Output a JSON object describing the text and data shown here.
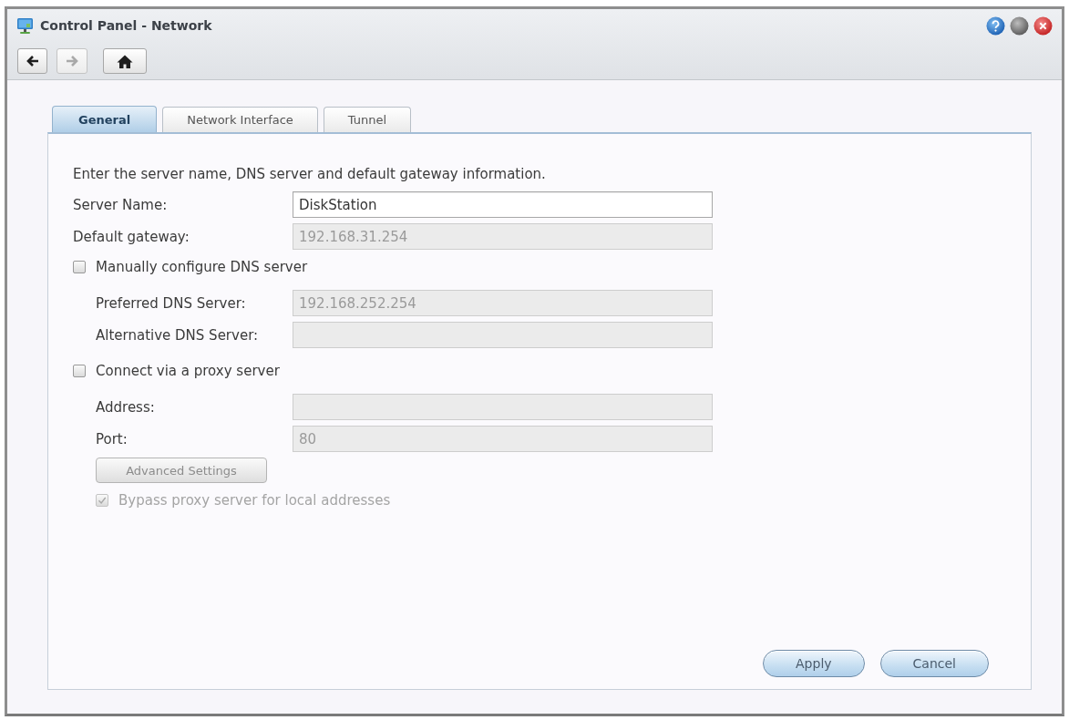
{
  "window": {
    "title": "Control Panel - Network"
  },
  "toolbar": [
    {
      "kind": "back",
      "disabled": false
    },
    {
      "kind": "forward",
      "disabled": true
    },
    {
      "kind": "home",
      "disabled": false
    }
  ],
  "tabs": [
    {
      "label": "General",
      "selected": true
    },
    {
      "label": "Network Interface",
      "selected": false
    },
    {
      "label": "Tunnel",
      "selected": false
    }
  ],
  "form": {
    "description": "Enter the server name, DNS server and default gateway information.",
    "items": [
      {
        "kind": "field",
        "label": "Server Name:",
        "value": "DiskStation",
        "disabled": false
      },
      {
        "kind": "field",
        "label": "Default gateway:",
        "value": "192.168.31.254",
        "disabled": true
      },
      {
        "kind": "checkbox",
        "label": "Manually configure DNS server",
        "checked": false,
        "disabled": false,
        "children": [
          {
            "kind": "field",
            "label": "Preferred DNS Server:",
            "value": "192.168.252.254",
            "disabled": true
          },
          {
            "kind": "field",
            "label": "Alternative DNS Server:",
            "disabled": true
          }
        ]
      },
      {
        "kind": "checkbox",
        "label": "Connect via a proxy server",
        "checked": false,
        "disabled": false,
        "children": [
          {
            "kind": "field",
            "label": "Address:",
            "disabled": true
          },
          {
            "kind": "field",
            "label": "Port:",
            "value": "80",
            "disabled": true
          },
          {
            "kind": "button",
            "label": "Advanced Settings",
            "disabled": true
          },
          {
            "kind": "checkbox",
            "label": "Bypass proxy server for local addresses",
            "checked": true,
            "disabled": true
          }
        ]
      }
    ]
  },
  "buttons": [
    {
      "label": "Apply"
    },
    {
      "label": "Cancel"
    }
  ]
}
